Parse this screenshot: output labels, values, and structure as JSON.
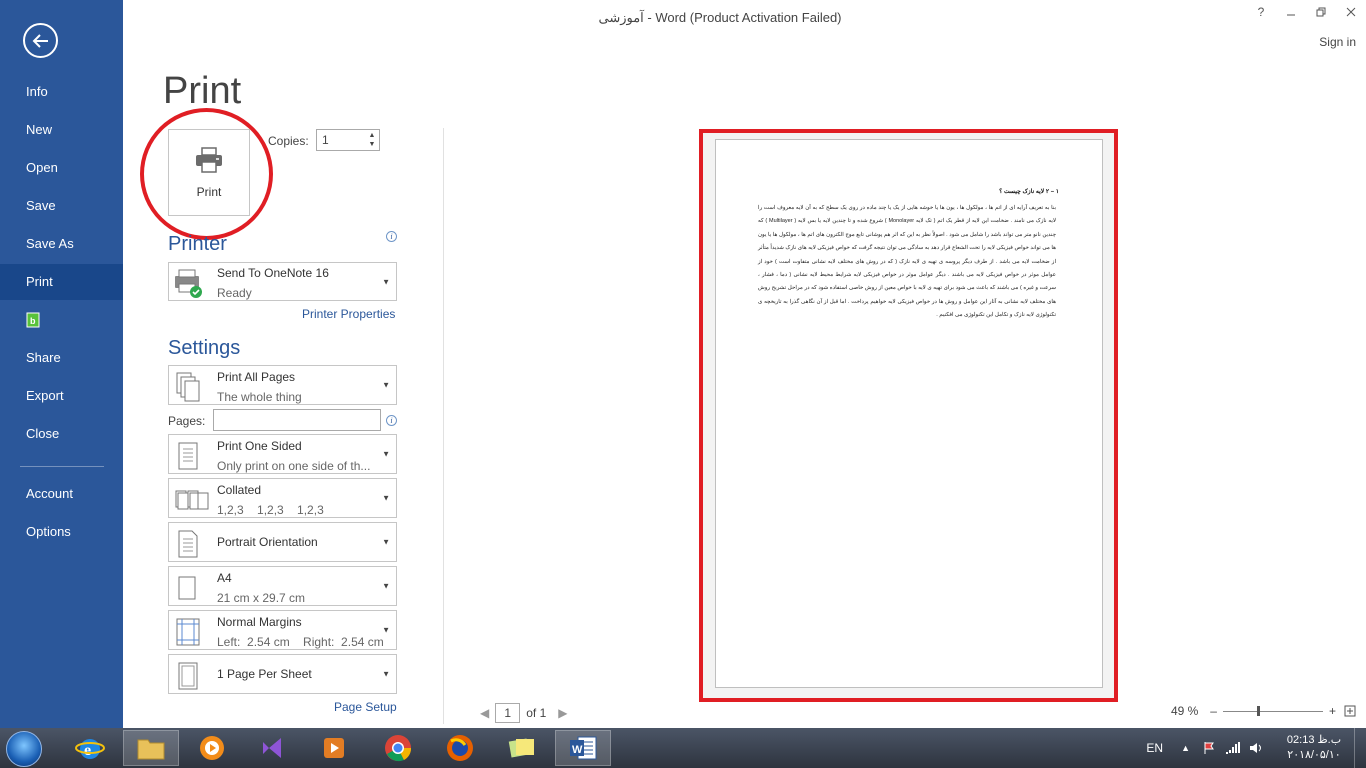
{
  "window": {
    "title": "آموزشی - Word (Product Activation Failed)",
    "help": "?",
    "signin": "Sign in"
  },
  "sidebar": {
    "items": [
      {
        "label": "Info"
      },
      {
        "label": "New"
      },
      {
        "label": "Open"
      },
      {
        "label": "Save"
      },
      {
        "label": "Save As"
      },
      {
        "label": "Print",
        "active": true
      },
      {
        "label": ""
      },
      {
        "label": "Share"
      },
      {
        "label": "Export"
      },
      {
        "label": "Close"
      },
      {
        "label": "Account"
      },
      {
        "label": "Options"
      }
    ]
  },
  "print": {
    "title": "Print",
    "button_label": "Print",
    "copies_label": "Copies:",
    "copies_value": "1"
  },
  "printer": {
    "section_title": "Printer",
    "name": "Send To OneNote 16",
    "status": "Ready",
    "properties_link": "Printer Properties"
  },
  "settings": {
    "section_title": "Settings",
    "pages_label": "Pages:",
    "pages_value": "",
    "page_setup_link": "Page Setup",
    "options": [
      {
        "main": "Print All Pages",
        "sub": "The whole thing"
      },
      {
        "main": "Print One Sided",
        "sub": "Only print on one side of th..."
      },
      {
        "main": "Collated",
        "sub": "1,2,3    1,2,3    1,2,3"
      },
      {
        "main": "Portrait Orientation",
        "sub": ""
      },
      {
        "main": "A4",
        "sub": "21 cm x 29.7 cm"
      },
      {
        "main": "Normal Margins",
        "sub": "Left:  2.54 cm    Right:  2.54 cm"
      },
      {
        "main": "1 Page Per Sheet",
        "sub": ""
      }
    ]
  },
  "preview": {
    "heading": "۱ – ۲ لایه نازک چیست ؟",
    "body": "بنا به تعریف آرایه ای از اتم ها ، مولکول ها ، یون ها یا خوشه هایی از یک یا چند ماده در روی یک سطح که به آن لایه معروف است را لایه نازک می نامند . ضخامت این لایه از قطر یک اتم ( تک لایه Monolayer ) شروع شده و تا چندین لایه یا بس لایه ( Multilayer ) که چندین نانو متر می تواند باشد را شامل می شود . اصولاً نظر به این که اثر هم پوشانی تابع موج الکترون های اتم ها ، مولکول ها یا یون ها می تواند خواص فیزیکی لایه را تحت الشعاع قرار دهد به سادگی می توان نتیجه گرفت که خواص فیزیکی لایه های نازک شدیداً متأثر از ضخامت لایه می باشد . از طرف دیگر پروسه ی تهیه ی لایه نازک ( که در روش های مختلف لایه نشانی متفاوت است ) خود از عوامل موثر در خواص فیزیکی لایه می باشند . دیگر عوامل موثر در خواص فیزیکی لایه شرایط محیط لایه نشانی ( دما ، فشار ، سرعت و غیره ) می باشند که باعث می شود برای تهیه ی لایه با خواص معین از روش خاصی استفاده شود که در مراحل تشریح روش های مختلف لایه نشانی به آثار این عوامل و روش ها در خواص فیزیکی لایه خواهیم پرداخت . اما قبل از آن نگاهی گذرا به تاریخچه ی تکنولوژی لایه نازک و تکامل این تکنولوژی می افکنیم ."
  },
  "pager": {
    "current": "1",
    "total": "of 1"
  },
  "zoom": {
    "level": "49 %",
    "minus": "–",
    "plus": "+"
  },
  "taskbar": {
    "lang": "EN",
    "time": "02:13 ب.ظ",
    "date": "۲۰۱۸/۰۵/۱۰"
  }
}
